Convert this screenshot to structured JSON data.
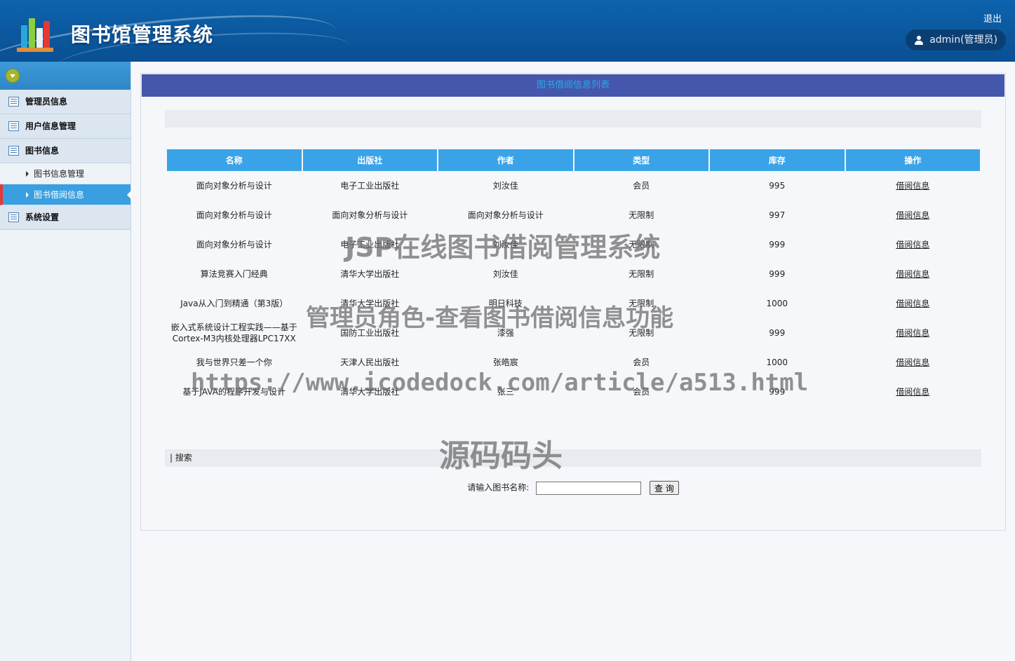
{
  "header": {
    "title": "图书馆管理系统",
    "logout_label": "退出",
    "user_label": "admin(管理员)"
  },
  "sidebar": {
    "groups": [
      {
        "label": "管理员信息",
        "icon": "list-icon"
      },
      {
        "label": "用户信息管理",
        "icon": "list-icon"
      },
      {
        "label": "图书信息",
        "icon": "list-icon",
        "children": [
          {
            "label": "图书信息管理",
            "active": false
          },
          {
            "label": "图书借阅信息",
            "active": true
          }
        ]
      },
      {
        "label": "系统设置",
        "icon": "list-icon"
      }
    ]
  },
  "main": {
    "panel_title": "图书借阅信息列表",
    "columns": [
      "名称",
      "出版社",
      "作者",
      "类型",
      "库存",
      "操作"
    ],
    "rows": [
      {
        "name": "面向对象分析与设计",
        "publisher": "电子工业出版社",
        "author": "刘汝佳",
        "type": "会员",
        "stock": "995",
        "action": "借阅信息"
      },
      {
        "name": "面向对象分析与设计",
        "publisher": "面向对象分析与设计",
        "author": "面向对象分析与设计",
        "type": "无限制",
        "stock": "997",
        "action": "借阅信息"
      },
      {
        "name": "面向对象分析与设计",
        "publisher": "电子工业出版社",
        "author": "刘汝佳",
        "type": "无限制",
        "stock": "999",
        "action": "借阅信息"
      },
      {
        "name": "算法竞赛入门经典",
        "publisher": "清华大学出版社",
        "author": "刘汝佳",
        "type": "无限制",
        "stock": "999",
        "action": "借阅信息"
      },
      {
        "name": "Java从入门到精通（第3版）",
        "publisher": "清华大学出版社",
        "author": "明日科技",
        "type": "无限制",
        "stock": "1000",
        "action": "借阅信息"
      },
      {
        "name": "嵌入式系统设计工程实践——基于Cortex-M3内核处理器LPC17XX",
        "publisher": "国防工业出版社",
        "author": "漆强",
        "type": "无限制",
        "stock": "999",
        "action": "借阅信息"
      },
      {
        "name": "我与世界只差一个你",
        "publisher": "天津人民出版社",
        "author": "张皓宸",
        "type": "会员",
        "stock": "1000",
        "action": "借阅信息"
      },
      {
        "name": "基于JAVA的程序开发与设计",
        "publisher": "清华大学出版社",
        "author": "张三",
        "type": "会员",
        "stock": "999",
        "action": "借阅信息"
      }
    ],
    "search_section_label": "| 搜索",
    "search_prompt": "请输入图书名称:",
    "search_value": "",
    "search_button": "查 询"
  },
  "watermarks": [
    "JSP在线图书借阅管理系统",
    "管理员角色-查看图书借阅信息功能",
    "https://www.icodedock.com/article/a513.html",
    "源码码头"
  ],
  "colors": {
    "header_bg": "#0d63ad",
    "panel_title_bg": "#4557ad",
    "table_header_bg": "#3aa3e8",
    "active_menu_bg": "#3a9fe0"
  }
}
